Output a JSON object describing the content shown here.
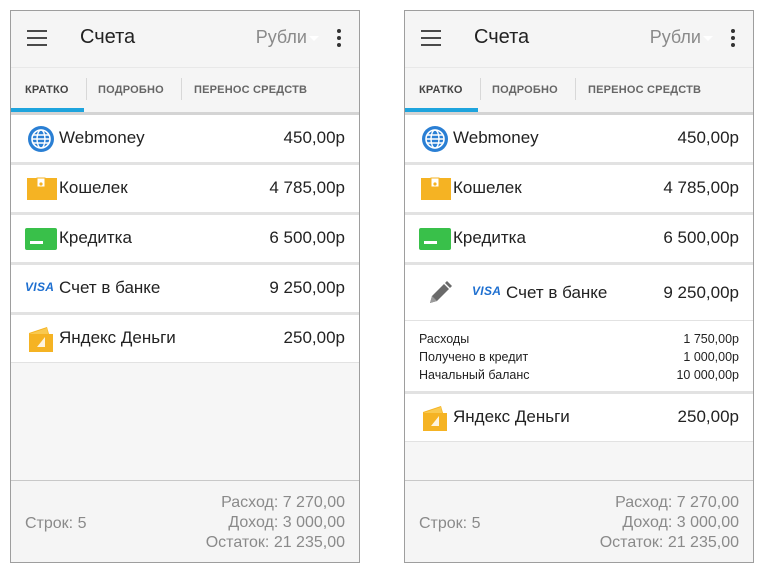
{
  "appbar": {
    "title": "Счета",
    "currency": "Рубли"
  },
  "tabs": [
    {
      "label": "КРАТКО",
      "active": true
    },
    {
      "label": "ПОДРОБНО",
      "active": false
    },
    {
      "label": "ПЕРЕНОС СРЕДСТВ",
      "active": false
    }
  ],
  "accounts": [
    {
      "name": "Webmoney",
      "amount": "450,00р",
      "icon": "webmoney-globe-icon"
    },
    {
      "name": "Кошелек",
      "amount": "4 785,00р",
      "icon": "wallet-icon"
    },
    {
      "name": "Кредитка",
      "amount": "6 500,00р",
      "icon": "credit-card-icon"
    },
    {
      "name": "Счет в банке",
      "amount": "9 250,00р",
      "icon": "visa-icon",
      "icon_text": "VISA"
    },
    {
      "name": "Яндекс Деньги",
      "amount": "250,00р",
      "icon": "yandex-money-icon"
    }
  ],
  "expanded_details": [
    {
      "label": "Расходы",
      "value": "1 750,00р"
    },
    {
      "label": "Получено в кредит",
      "value": "1 000,00р"
    },
    {
      "label": "Начальный баланс",
      "value": "10 000,00р"
    }
  ],
  "footer": {
    "rows_count": "Строк: 5",
    "expense": "Расход: 7 270,00",
    "income": "Доход: 3 000,00",
    "balance": "Остаток: 21 235,00"
  },
  "colors": {
    "accent": "#1ea4dd",
    "wallet": "#f5b323",
    "card": "#39c04a",
    "visa": "#1e6fd0",
    "webmoney": "#2a7fd4"
  }
}
